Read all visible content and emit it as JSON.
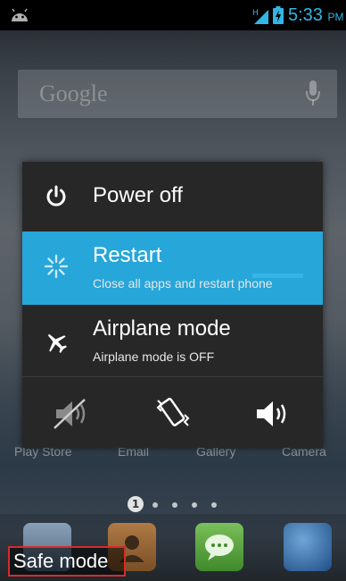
{
  "status_bar": {
    "time": "5:33",
    "ampm": "PM",
    "network_type": "H",
    "accent_color": "#33b5e5",
    "icons": [
      "android-notification-icon",
      "signal-icon",
      "battery-charging-icon"
    ]
  },
  "search": {
    "placeholder": "Google",
    "icon": "mic-icon"
  },
  "power_menu": {
    "items": [
      {
        "title": "Power off",
        "subtitle": "",
        "icon": "power-icon"
      },
      {
        "title": "Restart",
        "subtitle": "Close all apps and restart phone",
        "icon": "restart-icon",
        "highlighted": true
      },
      {
        "title": "Airplane mode",
        "subtitle": "Airplane mode is OFF",
        "icon": "airplane-icon"
      }
    ],
    "sound_modes": [
      {
        "name": "silent",
        "icon": "volume-muted-icon",
        "selected": false
      },
      {
        "name": "vibrate",
        "icon": "vibrate-icon",
        "selected": false
      },
      {
        "name": "sound",
        "icon": "volume-on-icon",
        "selected": true
      }
    ],
    "highlight_color": "#26a6d9"
  },
  "home": {
    "app_labels": [
      "Play Store",
      "Email",
      "Gallery",
      "Camera"
    ],
    "page_indicator": {
      "current": "1",
      "total_dots": 5
    },
    "dock_icons": [
      "phone-icon",
      "contacts-icon",
      "messaging-icon",
      "browser-icon"
    ]
  },
  "safe_mode_label": "Safe mode"
}
